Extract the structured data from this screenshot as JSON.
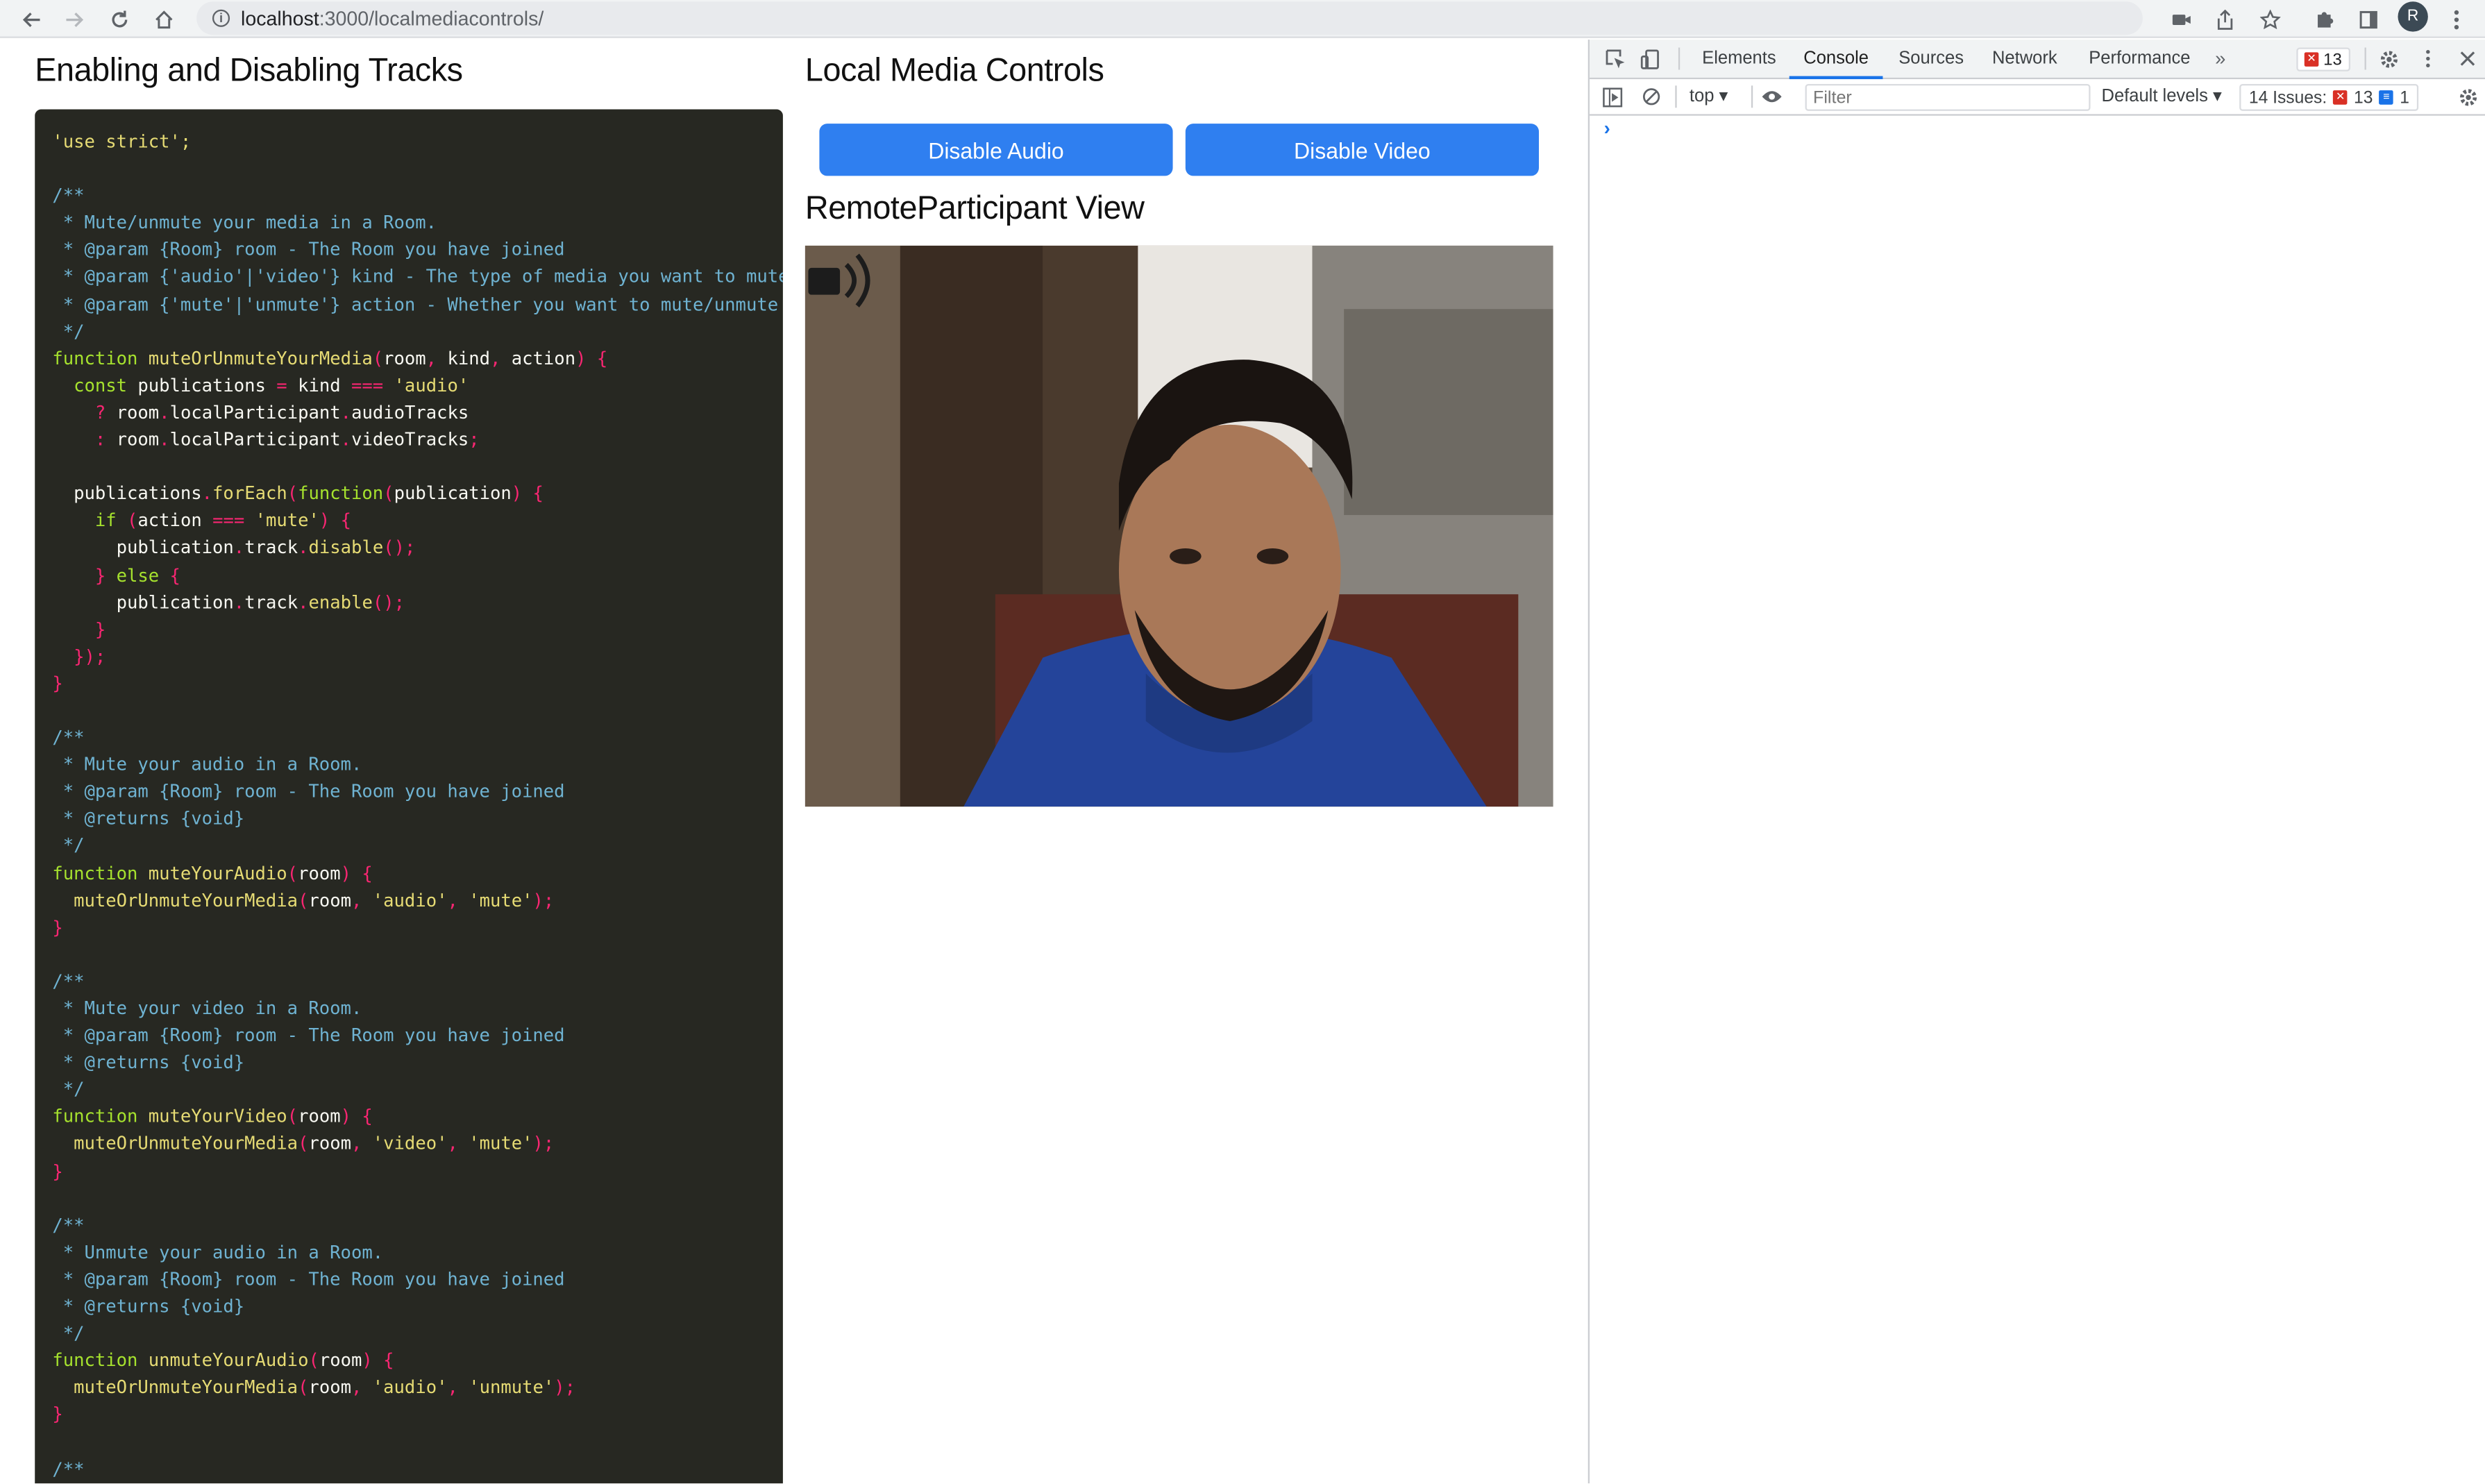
{
  "browser": {
    "url_host": "localhost",
    "url_path": ":3000/localmediacontrols/",
    "profile_initial": "R"
  },
  "page": {
    "code_heading": "Enabling and Disabling Tracks",
    "controls_heading": "Local Media Controls",
    "disable_audio_label": "Disable Audio",
    "disable_video_label": "Disable Video",
    "remote_heading": "RemoteParticipant View"
  },
  "code": {
    "lines": [
      [
        [
          "'use strict';",
          "st"
        ]
      ],
      [],
      [
        [
          "/**",
          "cm"
        ]
      ],
      [
        [
          " * Mute/unmute your media in a Room.",
          "cm"
        ]
      ],
      [
        [
          " * @param {Room} room - The Room you have joined",
          "cm"
        ]
      ],
      [
        [
          " * @param {'audio'|'video'} kind - The type of media you want to mute/unmute",
          "cm"
        ]
      ],
      [
        [
          " * @param {'mute'|'unmute'} action - Whether you want to mute/unmute",
          "cm"
        ]
      ],
      [
        [
          " */",
          "cm"
        ]
      ],
      [
        [
          "function",
          "kw"
        ],
        [
          " muteOrUnmuteYourMedia",
          "fn"
        ],
        [
          "(",
          "pu"
        ],
        [
          "room",
          "pl"
        ],
        [
          ", ",
          "pu"
        ],
        [
          "kind",
          "pl"
        ],
        [
          ", ",
          "pu"
        ],
        [
          "action",
          "pl"
        ],
        [
          ") {",
          "pu"
        ]
      ],
      [
        [
          "  const",
          "kw"
        ],
        [
          " publications ",
          "pl"
        ],
        [
          "=",
          "pu"
        ],
        [
          " kind ",
          "pl"
        ],
        [
          "===",
          "pu"
        ],
        [
          " 'audio'",
          "st"
        ]
      ],
      [
        [
          "    ?",
          "pu"
        ],
        [
          " room",
          "pl"
        ],
        [
          ".",
          "pu"
        ],
        [
          "localParticipant",
          "pl"
        ],
        [
          ".",
          "pu"
        ],
        [
          "audioTracks",
          "pl"
        ]
      ],
      [
        [
          "    :",
          "pu"
        ],
        [
          " room",
          "pl"
        ],
        [
          ".",
          "pu"
        ],
        [
          "localParticipant",
          "pl"
        ],
        [
          ".",
          "pu"
        ],
        [
          "videoTracks",
          "pl"
        ],
        [
          ";",
          "pu"
        ]
      ],
      [],
      [
        [
          "  publications",
          "pl"
        ],
        [
          ".",
          "pu"
        ],
        [
          "forEach",
          "fn"
        ],
        [
          "(",
          "pu"
        ],
        [
          "function",
          "kw"
        ],
        [
          "(",
          "pu"
        ],
        [
          "publication",
          "pl"
        ],
        [
          ") {",
          "pu"
        ]
      ],
      [
        [
          "    if",
          "kw"
        ],
        [
          " (",
          "pu"
        ],
        [
          "action ",
          "pl"
        ],
        [
          "===",
          "pu"
        ],
        [
          " 'mute'",
          "st"
        ],
        [
          ") {",
          "pu"
        ]
      ],
      [
        [
          "      publication",
          "pl"
        ],
        [
          ".",
          "pu"
        ],
        [
          "track",
          "pl"
        ],
        [
          ".",
          "pu"
        ],
        [
          "disable",
          "fn"
        ],
        [
          "();",
          "pu"
        ]
      ],
      [
        [
          "    } ",
          "pu"
        ],
        [
          "else",
          "kw"
        ],
        [
          " {",
          "pu"
        ]
      ],
      [
        [
          "      publication",
          "pl"
        ],
        [
          ".",
          "pu"
        ],
        [
          "track",
          "pl"
        ],
        [
          ".",
          "pu"
        ],
        [
          "enable",
          "fn"
        ],
        [
          "();",
          "pu"
        ]
      ],
      [
        [
          "    }",
          "pu"
        ]
      ],
      [
        [
          "  });",
          "pu"
        ]
      ],
      [
        [
          "}",
          "pu"
        ]
      ],
      [],
      [
        [
          "/**",
          "cm"
        ]
      ],
      [
        [
          " * Mute your audio in a Room.",
          "cm"
        ]
      ],
      [
        [
          " * @param {Room} room - The Room you have joined",
          "cm"
        ]
      ],
      [
        [
          " * @returns {void}",
          "cm"
        ]
      ],
      [
        [
          " */",
          "cm"
        ]
      ],
      [
        [
          "function",
          "kw"
        ],
        [
          " muteYourAudio",
          "fn"
        ],
        [
          "(",
          "pu"
        ],
        [
          "room",
          "pl"
        ],
        [
          ") {",
          "pu"
        ]
      ],
      [
        [
          "  muteOrUnmuteYourMedia",
          "fn"
        ],
        [
          "(",
          "pu"
        ],
        [
          "room",
          "pl"
        ],
        [
          ", ",
          "pu"
        ],
        [
          "'audio'",
          "st"
        ],
        [
          ", ",
          "pu"
        ],
        [
          "'mute'",
          "st"
        ],
        [
          ");",
          "pu"
        ]
      ],
      [
        [
          "}",
          "pu"
        ]
      ],
      [],
      [
        [
          "/**",
          "cm"
        ]
      ],
      [
        [
          " * Mute your video in a Room.",
          "cm"
        ]
      ],
      [
        [
          " * @param {Room} room - The Room you have joined",
          "cm"
        ]
      ],
      [
        [
          " * @returns {void}",
          "cm"
        ]
      ],
      [
        [
          " */",
          "cm"
        ]
      ],
      [
        [
          "function",
          "kw"
        ],
        [
          " muteYourVideo",
          "fn"
        ],
        [
          "(",
          "pu"
        ],
        [
          "room",
          "pl"
        ],
        [
          ") {",
          "pu"
        ]
      ],
      [
        [
          "  muteOrUnmuteYourMedia",
          "fn"
        ],
        [
          "(",
          "pu"
        ],
        [
          "room",
          "pl"
        ],
        [
          ", ",
          "pu"
        ],
        [
          "'video'",
          "st"
        ],
        [
          ", ",
          "pu"
        ],
        [
          "'mute'",
          "st"
        ],
        [
          ");",
          "pu"
        ]
      ],
      [
        [
          "}",
          "pu"
        ]
      ],
      [],
      [
        [
          "/**",
          "cm"
        ]
      ],
      [
        [
          " * Unmute your audio in a Room.",
          "cm"
        ]
      ],
      [
        [
          " * @param {Room} room - The Room you have joined",
          "cm"
        ]
      ],
      [
        [
          " * @returns {void}",
          "cm"
        ]
      ],
      [
        [
          " */",
          "cm"
        ]
      ],
      [
        [
          "function",
          "kw"
        ],
        [
          " unmuteYourAudio",
          "fn"
        ],
        [
          "(",
          "pu"
        ],
        [
          "room",
          "pl"
        ],
        [
          ") {",
          "pu"
        ]
      ],
      [
        [
          "  muteOrUnmuteYourMedia",
          "fn"
        ],
        [
          "(",
          "pu"
        ],
        [
          "room",
          "pl"
        ],
        [
          ", ",
          "pu"
        ],
        [
          "'audio'",
          "st"
        ],
        [
          ", ",
          "pu"
        ],
        [
          "'unmute'",
          "st"
        ],
        [
          ");",
          "pu"
        ]
      ],
      [
        [
          "}",
          "pu"
        ]
      ],
      [],
      [
        [
          "/**",
          "cm"
        ]
      ]
    ]
  },
  "devtools": {
    "tabs": [
      "Elements",
      "Console",
      "Sources",
      "Network",
      "Performance"
    ],
    "active_tab": "Console",
    "error_count": "13",
    "context": "top",
    "filter_placeholder": "Filter",
    "levels": "Default levels",
    "issues_label": "14 Issues:",
    "issues_errors": "13",
    "issues_info": "1",
    "prompt": "›"
  },
  "colors": {
    "button_blue": "#2f7ff0",
    "code_bg": "#272822",
    "devtools_accent": "#1a73e8",
    "error_red": "#d93025"
  },
  "icons": [
    "back-icon",
    "forward-icon",
    "reload-icon",
    "home-icon",
    "info-icon",
    "camera-icon",
    "share-icon",
    "star-icon",
    "extensions-icon",
    "sidepanel-icon",
    "menu-icon",
    "inspect-icon",
    "device-icon",
    "settings-icon",
    "close-icon",
    "sidebar-icon",
    "clear-icon",
    "eye-icon",
    "speaker-icon"
  ]
}
